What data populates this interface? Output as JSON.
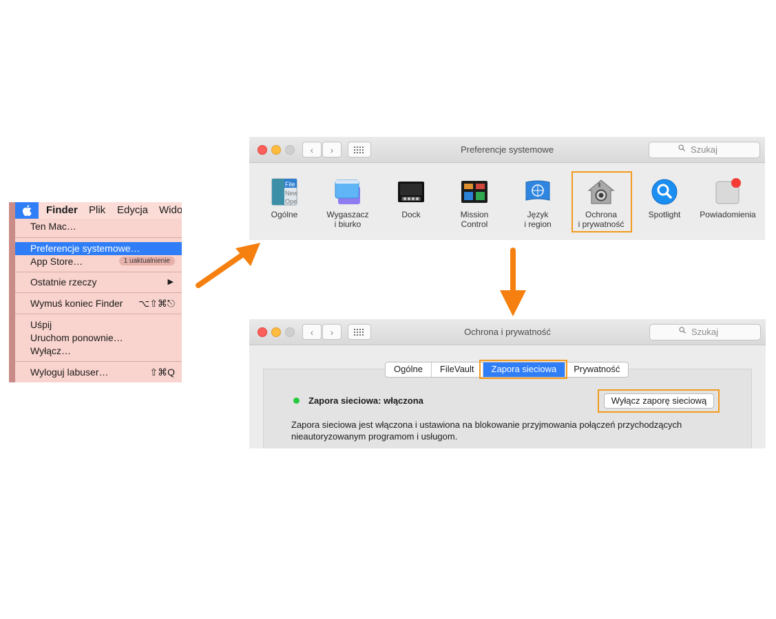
{
  "colors": {
    "accent": "#f39a1b",
    "selection": "#2f7ef7",
    "menu_bg": "#f9d3cd",
    "status_on": "#27c93f"
  },
  "finder_menu": {
    "menubar": {
      "apple": "",
      "app": "Finder",
      "items": [
        "Plik",
        "Edycja",
        "Wido"
      ]
    },
    "items": {
      "ten_mac": "Ten Mac…",
      "preferencje": "Preferencje systemowe…",
      "app_store": "App Store…",
      "app_store_badge": "1 uaktualnienie",
      "ostatnie": "Ostatnie rzeczy",
      "wymus": "Wymuś koniec Finder",
      "wymus_shortcut": "⌥⇧⌘⎋",
      "uspij": "Uśpij",
      "uruchom": "Uruchom ponownie…",
      "wylacz": "Wyłącz…",
      "wyloguj": "Wyloguj labuser…",
      "wyloguj_shortcut": "⇧⌘Q"
    }
  },
  "prefs_window": {
    "title": "Preferencje systemowe",
    "search_placeholder": "Szukaj",
    "panes": [
      {
        "line1": "Ogólne",
        "line2": "",
        "icon": "general-icon"
      },
      {
        "line1": "Wygaszacz",
        "line2": "i biurko",
        "icon": "desktop-screensaver-icon"
      },
      {
        "line1": "Dock",
        "line2": "",
        "icon": "dock-icon"
      },
      {
        "line1": "Mission",
        "line2": "Control",
        "icon": "mission-control-icon"
      },
      {
        "line1": "Język",
        "line2": "i region",
        "icon": "language-region-icon"
      },
      {
        "line1": "Ochrona",
        "line2": "i prywatność",
        "icon": "security-house-icon"
      },
      {
        "line1": "Spotlight",
        "line2": "",
        "icon": "spotlight-icon"
      },
      {
        "line1": "Powiadomienia",
        "line2": "",
        "icon": "notifications-icon"
      }
    ],
    "general_icon_text": [
      "File",
      "New",
      "Ope"
    ]
  },
  "security_window": {
    "title": "Ochrona i prywatność",
    "search_placeholder": "Szukaj",
    "tabs": [
      "Ogólne",
      "FileVault",
      "Zapora sieciowa",
      "Prywatność"
    ],
    "active_tab": "Zapora sieciowa",
    "status": "Zapora sieciowa: włączona",
    "button": "Wyłącz zaporę sieciową",
    "description": "Zapora sieciowa jest włączona i ustawiona na blokowanie przyjmowania połączeń przychodzących nieautoryzowanym programom i usługom."
  }
}
